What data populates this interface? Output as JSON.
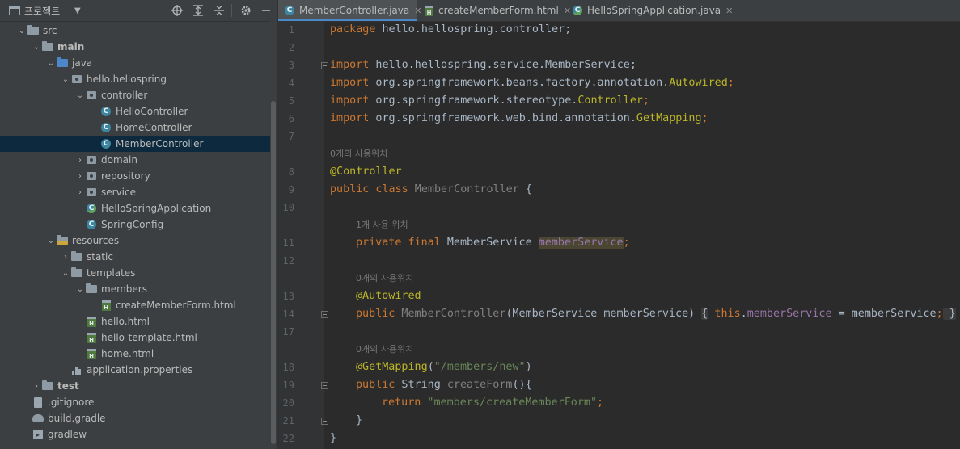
{
  "project_panel": {
    "title": "프로젝트",
    "tree": [
      {
        "label": "src",
        "icon": "folder-icon",
        "expanded": true
      },
      {
        "label": "main",
        "icon": "source-folder-icon",
        "expanded": true
      },
      {
        "label": "java",
        "icon": "source-folder-icon",
        "expanded": true
      },
      {
        "label": "hello.hellospring",
        "icon": "package-icon",
        "expanded": true
      },
      {
        "label": "controller",
        "icon": "package-icon",
        "expanded": true
      },
      {
        "label": "HelloController",
        "icon": "class-icon"
      },
      {
        "label": "HomeController",
        "icon": "class-icon"
      },
      {
        "label": "MemberController",
        "icon": "class-icon",
        "selected": true
      },
      {
        "label": "domain",
        "icon": "package-icon",
        "expanded": false
      },
      {
        "label": "repository",
        "icon": "package-icon",
        "expanded": false
      },
      {
        "label": "service",
        "icon": "package-icon",
        "expanded": false
      },
      {
        "label": "HelloSpringApplication",
        "icon": "spring-class-icon"
      },
      {
        "label": "SpringConfig",
        "icon": "class-icon"
      },
      {
        "label": "resources",
        "icon": "resources-folder-icon",
        "expanded": true
      },
      {
        "label": "static",
        "icon": "folder-icon",
        "expanded": false
      },
      {
        "label": "templates",
        "icon": "folder-icon",
        "expanded": true
      },
      {
        "label": "members",
        "icon": "folder-icon",
        "expanded": true
      },
      {
        "label": "createMemberForm.html",
        "icon": "html-file-icon"
      },
      {
        "label": "hello.html",
        "icon": "html-file-icon"
      },
      {
        "label": "hello-template.html",
        "icon": "html-file-icon"
      },
      {
        "label": "home.html",
        "icon": "html-file-icon"
      },
      {
        "label": "application.properties",
        "icon": "properties-file-icon"
      },
      {
        "label": "test",
        "icon": "test-folder-icon",
        "expanded": false
      },
      {
        "label": ".gitignore",
        "icon": "gitignore-file-icon"
      },
      {
        "label": "build.gradle",
        "icon": "gradle-icon"
      },
      {
        "label": "gradlew",
        "icon": "terminal-file-icon"
      }
    ]
  },
  "tabs": [
    {
      "label": "MemberController.java",
      "icon": "class-icon",
      "active": true
    },
    {
      "label": "createMemberForm.html",
      "icon": "html-file-icon",
      "active": false
    },
    {
      "label": "HelloSpringApplication.java",
      "icon": "spring-class-icon",
      "active": false
    }
  ],
  "editor": {
    "line_numbers": [
      "1",
      "2",
      "3",
      "4",
      "5",
      "6",
      "7",
      "8",
      "9",
      "10",
      "11",
      "12",
      "13",
      "14",
      "17",
      "18",
      "19",
      "20",
      "21",
      "22"
    ],
    "hints": {
      "h1": "0개의 사용위치",
      "h2": "1개 사용 위치",
      "h3": "0개의 사용위치",
      "h4": "0개의 사용위치"
    },
    "code": {
      "l1a": "package",
      "l1b": " hello.hellospring.controller;",
      "l3a": "import",
      "l3b": " hello.hellospring.service.MemberService;",
      "l4a": "import",
      "l4b": " org.springframework.beans.factory.annotation.",
      "l4c": "Autowired",
      "l4d": ";",
      "l5a": "import",
      "l5b": " org.springframework.stereotype.",
      "l5c": "Controller",
      "l5d": ";",
      "l6a": "import",
      "l6b": " org.springframework.web.bind.annotation.",
      "l6c": "GetMapping",
      "l6d": ";",
      "l8": "@Controller",
      "l9a": "public class",
      "l9b": " MemberController",
      "l9c": " {",
      "l11a": "private final",
      "l11b": " MemberService ",
      "l11c": "memberService",
      "l11d": ";",
      "l13": "@Autowired",
      "l14a": "public",
      "l14b": " MemberController",
      "l14c": "(MemberService memberService) ",
      "l14d": "{",
      "l14e": " this",
      "l14f": ".",
      "l14g": "memberService",
      "l14h": " = memberService",
      "l14i": ";",
      "l14j": " }",
      "l18a": "@GetMapping",
      "l18b": "(",
      "l18c": "\"/members/new\"",
      "l18d": ")",
      "l19a": "public",
      "l19b": " String ",
      "l19c": "createForm",
      "l19d": "(){",
      "l20a": "return",
      "l20b": " \"members/createMemberForm\"",
      "l20c": ";",
      "l21": "}",
      "l22": "}"
    }
  },
  "colors": {
    "keyword": "#cc7832",
    "annotation": "#bbb529",
    "string": "#6a8759",
    "field": "#9876aa",
    "text": "#a9b7c6",
    "selection": "#0d293e"
  }
}
